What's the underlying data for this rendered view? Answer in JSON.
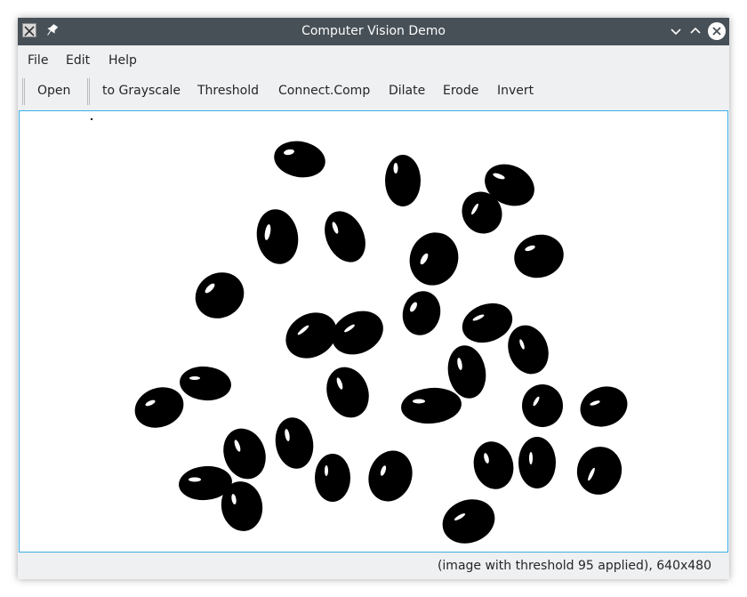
{
  "window": {
    "title": "Computer Vision Demo"
  },
  "menubar": {
    "items": [
      "File",
      "Edit",
      "Help"
    ]
  },
  "toolbar": {
    "open_label": "Open",
    "actions": [
      "to Grayscale",
      "Threshold",
      "Connect.Comp",
      "Dilate",
      "Erode",
      "Invert"
    ]
  },
  "image": {
    "threshold": 95
  },
  "status": {
    "text": "(image with threshold 95 applied), 640x480"
  }
}
